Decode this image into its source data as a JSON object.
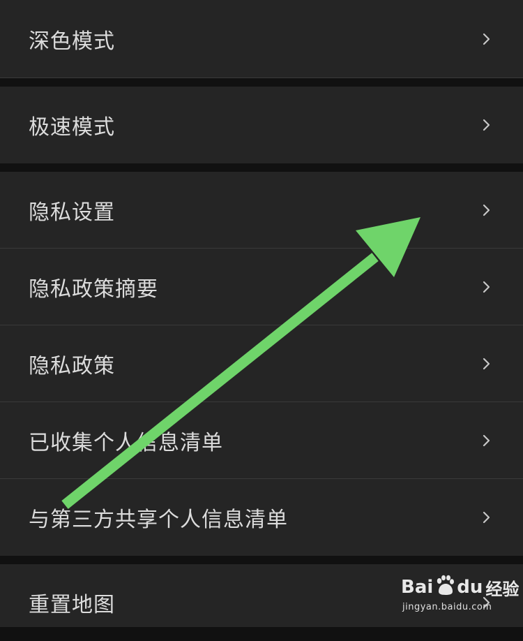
{
  "settings": {
    "items": [
      {
        "label": "深色模式"
      },
      {
        "label": "极速模式"
      },
      {
        "label": "隐私设置"
      },
      {
        "label": "隐私政策摘要"
      },
      {
        "label": "隐私政策"
      },
      {
        "label": "已收集个人信息清单"
      },
      {
        "label": "与第三方共享个人信息清单"
      },
      {
        "label": "重置地图"
      }
    ],
    "chevron_icon": "chevron-right-icon"
  },
  "overlay": {
    "arrow_color": "#6fd46a",
    "arrow_icon": "annotation-arrow-icon"
  },
  "watermark": {
    "brand_left": "Bai",
    "brand_mid": "du",
    "brand_right": "经验",
    "url": "jingyan.baidu.com"
  },
  "colors": {
    "background": "#111111",
    "row_background": "#252525",
    "divider": "#3a3a3a",
    "label_text": "#dcdcdc",
    "chevron": "#c8c8c8"
  }
}
